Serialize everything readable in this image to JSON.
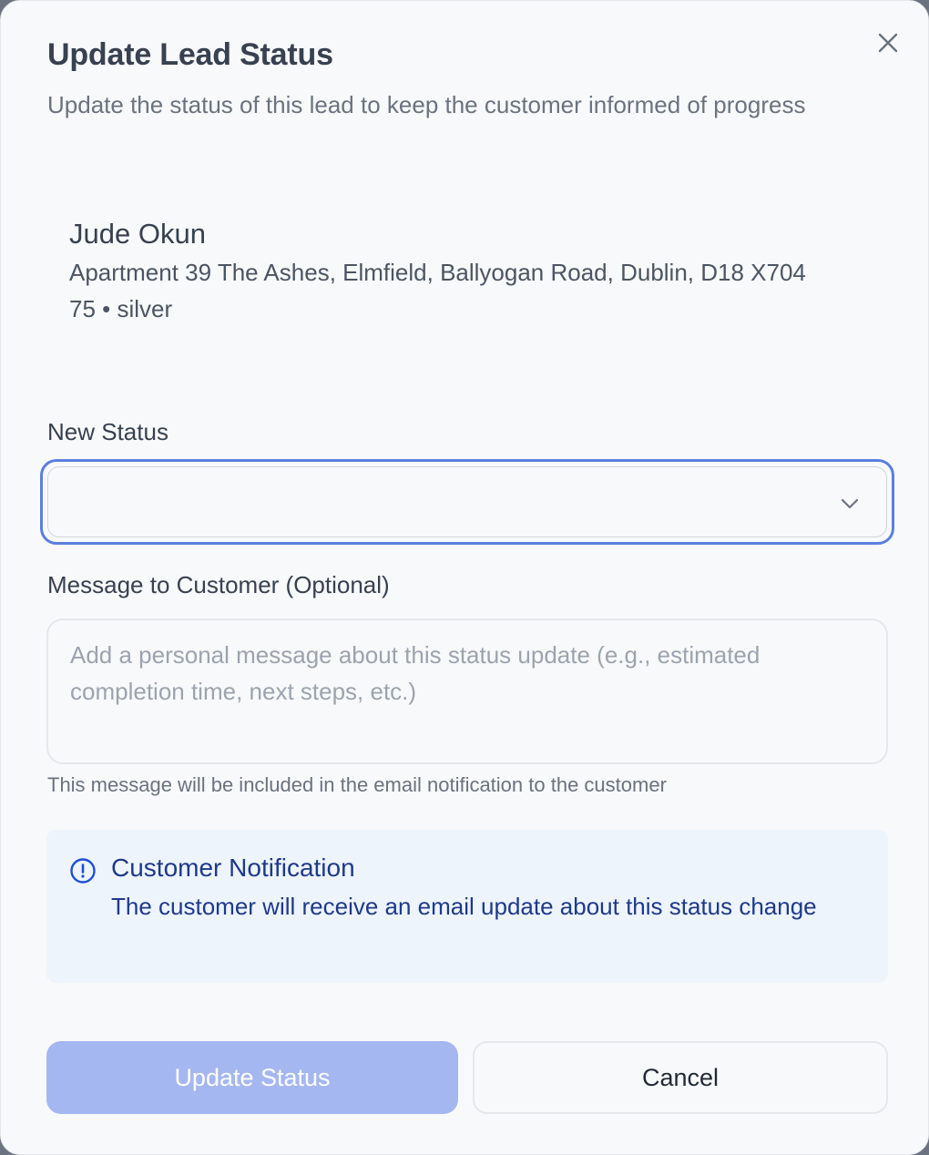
{
  "dialog": {
    "title": "Update Lead Status",
    "subtitle": "Update the status of this lead to keep the customer informed of progress",
    "close_icon": "close-icon"
  },
  "lead": {
    "name": "Jude Okun",
    "address": "Apartment 39 The Ashes, Elmfield, Ballyogan Road, Dublin, D18 X704",
    "details": "75 • silver"
  },
  "status": {
    "label": "New Status",
    "value": "",
    "icon": "chevron-down-icon"
  },
  "message": {
    "label": "Message to Customer (Optional)",
    "value": "",
    "placeholder": "Add a personal message about this status update (e.g., estimated completion time, next steps, etc.)",
    "helper": "This message will be included in the email notification to the customer"
  },
  "notice": {
    "icon": "info-circle-icon",
    "title": "Customer Notification",
    "text": "The customer will receive an email update about this status change"
  },
  "actions": {
    "submit_label": "Update Status",
    "cancel_label": "Cancel"
  },
  "colors": {
    "accent_border": "#5b7fe0",
    "primary_disabled": "#a5b7f0",
    "notice_bg": "#eef4fc",
    "notice_text": "#1e3a8a"
  }
}
